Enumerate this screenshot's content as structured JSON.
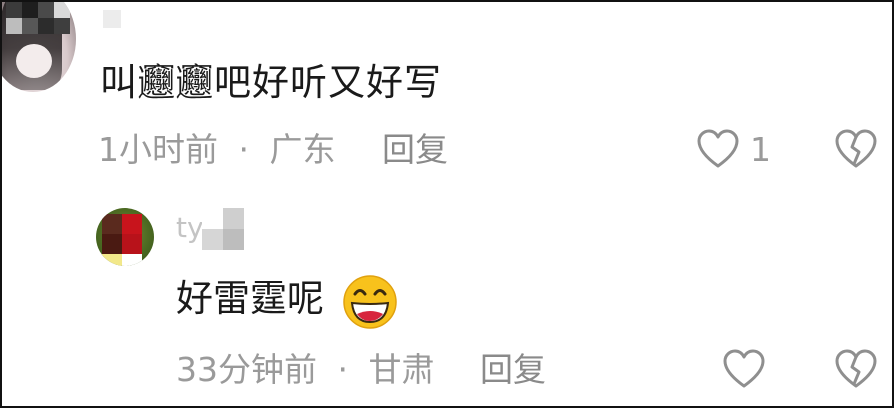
{
  "comments": [
    {
      "avatar": "user-avatar-blurred",
      "text": "叫𰻝𰻝吧好听又好写",
      "time": "1小时前",
      "separator": "·",
      "location": "广东",
      "reply_label": "回复",
      "like_count": "1",
      "icons": {
        "like": "heart-outline-icon",
        "dislike": "broken-heart-icon"
      }
    },
    {
      "avatar": "user-avatar-blurred",
      "username_visible": "tyl",
      "text": "好雷霆呢",
      "emoji": "grinning-face-emoji",
      "time": "33分钟前",
      "separator": "·",
      "location": "甘肃",
      "reply_label": "回复",
      "icons": {
        "like": "heart-outline-icon",
        "dislike": "broken-heart-icon"
      }
    }
  ],
  "colors": {
    "text_primary": "#1a1a1a",
    "text_meta": "#9a9a9a",
    "icon_stroke": "#8f8f8f",
    "emoji_face": "#f8c21c",
    "emoji_mouth": "#d7263d"
  }
}
